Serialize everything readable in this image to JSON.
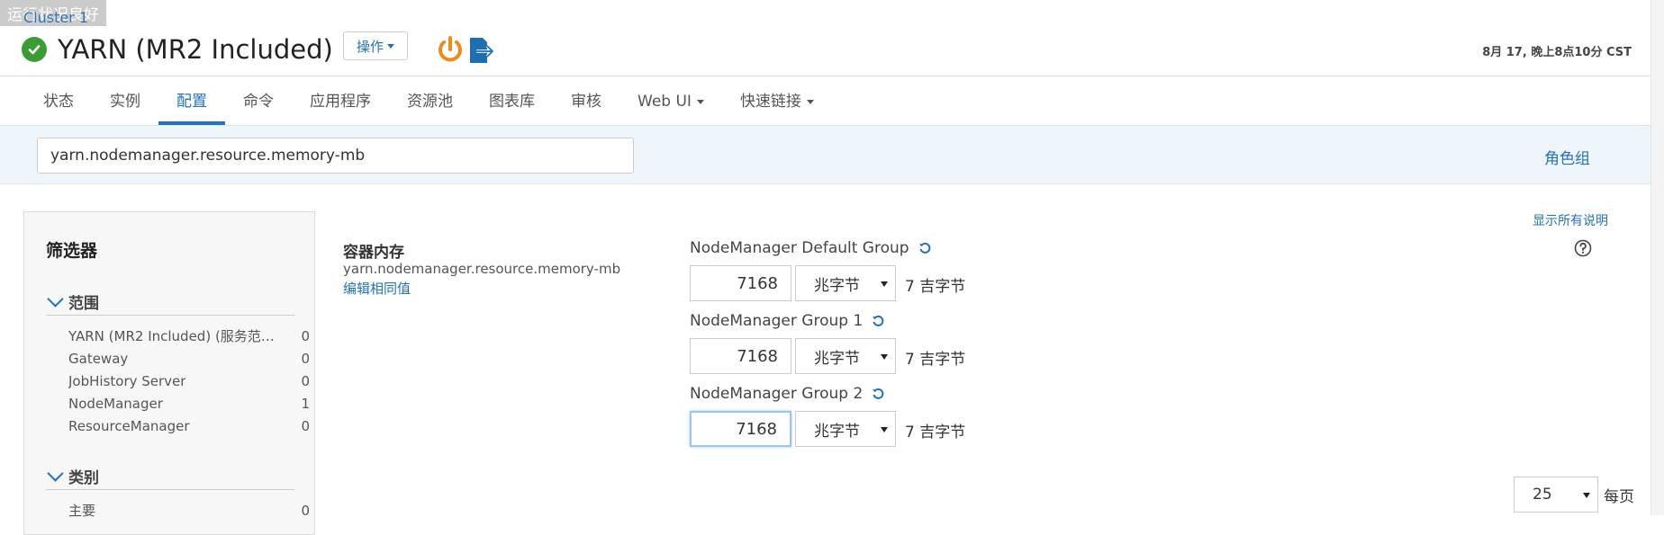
{
  "header": {
    "health_tooltip": "运行状况良好",
    "cluster_link": "Cluster 1",
    "service_title": "YARN (MR2 Included)",
    "actions_label": "操作",
    "timestamp": "8月 17, 晚上8点10分 CST"
  },
  "tabs": [
    {
      "label": "状态"
    },
    {
      "label": "实例"
    },
    {
      "label": "配置",
      "active": true
    },
    {
      "label": "命令"
    },
    {
      "label": "应用程序"
    },
    {
      "label": "资源池"
    },
    {
      "label": "图表库"
    },
    {
      "label": "审核"
    },
    {
      "label": "Web UI"
    },
    {
      "label": "快速链接"
    }
  ],
  "search": {
    "value": "yarn.nodemanager.resource.memory-mb",
    "role_groups_label": "角色组"
  },
  "filters": {
    "title": "筛选器",
    "scope_header": "范围",
    "scope_items": [
      {
        "label": "YARN (MR2 Included) (服务范围)",
        "display": "YARN (MR2 Included) (服务范…",
        "count": "0"
      },
      {
        "label": "Gateway",
        "count": "0"
      },
      {
        "label": "JobHistory Server",
        "count": "0"
      },
      {
        "label": "NodeManager",
        "count": "1"
      },
      {
        "label": "ResourceManager",
        "count": "0"
      }
    ],
    "category_header": "类别",
    "category_items": [
      {
        "label": "主要",
        "count": "0"
      }
    ]
  },
  "property": {
    "display_name": "容器内存",
    "key": "yarn.nodemanager.resource.memory-mb",
    "edit_identical": "编辑相同值",
    "groups": [
      {
        "name": "NodeManager Default Group",
        "value": "7168",
        "unit": "兆字节",
        "human": "7 吉字节"
      },
      {
        "name": "NodeManager Group 1",
        "value": "7168",
        "unit": "兆字节",
        "human": "7 吉字节"
      },
      {
        "name": "NodeManager Group 2",
        "value": "7168",
        "unit": "兆字节",
        "human": "7 吉字节"
      }
    ]
  },
  "right": {
    "show_all_desc": "显示所有说明"
  },
  "pagination": {
    "page_size": "25",
    "per_page_label": "每页"
  },
  "colors": {
    "accent": "#2373b7",
    "success": "#3c9b35",
    "power_orange": "#f08a1c",
    "search_band": "#eef5fb"
  }
}
